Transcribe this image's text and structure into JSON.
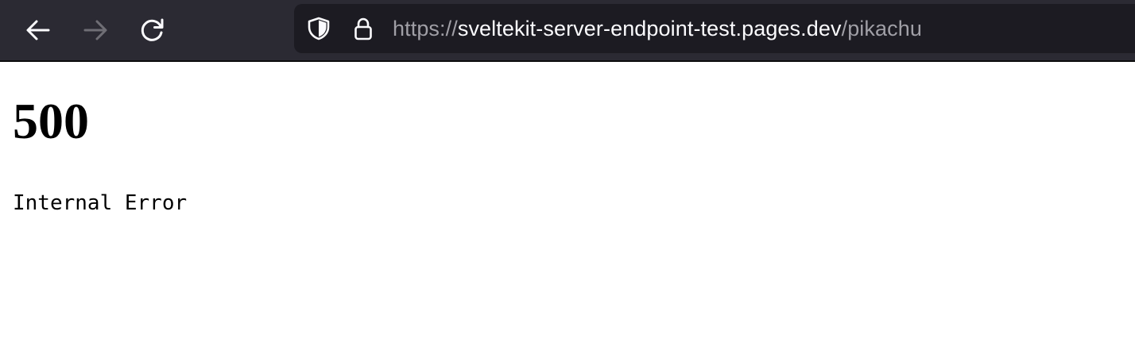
{
  "browser": {
    "nav": {
      "back_icon": "arrow-left-icon",
      "forward_icon": "arrow-right-icon",
      "reload_icon": "reload-icon"
    },
    "url": {
      "scheme": "https://",
      "host": "sveltekit-server-endpoint-test.pages.dev",
      "path": "/pikachu",
      "shield_icon": "shield-icon",
      "lock_icon": "lock-icon"
    },
    "colors": {
      "toolbar": "#2b2a33",
      "urlbar": "#1c1b22",
      "url_host": "#fbfbfe",
      "url_dim": "#a09fa6"
    }
  },
  "page": {
    "status_code": "500",
    "message": "Internal Error"
  }
}
